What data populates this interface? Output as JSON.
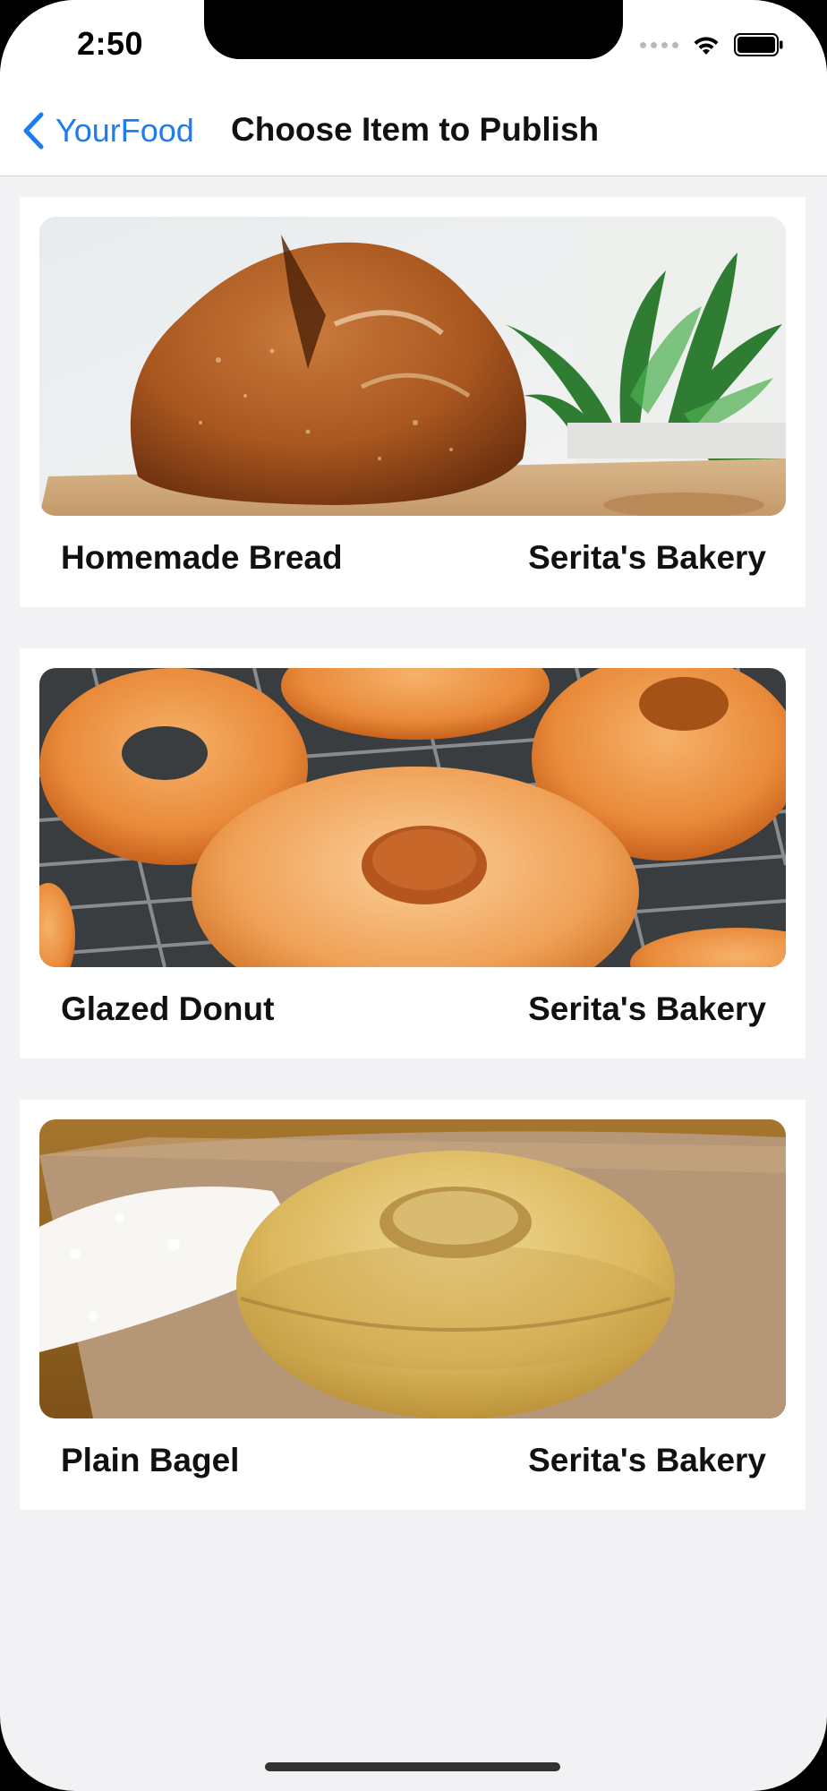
{
  "status_bar": {
    "time": "2:50",
    "icons": [
      "signal-icon",
      "wifi-icon",
      "battery-icon"
    ]
  },
  "nav": {
    "back_label": "YourFood",
    "title": "Choose Item to Publish",
    "accent_color": "#1c7cf1"
  },
  "items": [
    {
      "name": "Homemade Bread",
      "vendor": "Serita's Bakery",
      "image": "bread-photo"
    },
    {
      "name": "Glazed Donut",
      "vendor": "Serita's Bakery",
      "image": "donut-photo"
    },
    {
      "name": "Plain Bagel",
      "vendor": "Serita's Bakery",
      "image": "bagel-photo"
    }
  ]
}
